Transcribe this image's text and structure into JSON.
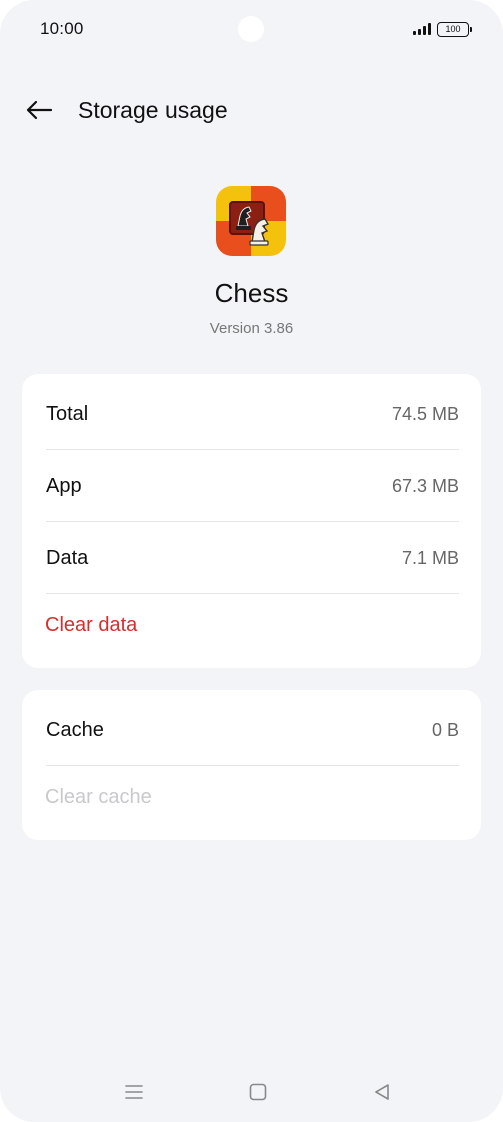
{
  "status_bar": {
    "time": "10:00",
    "battery_level": "100",
    "signal_icon": "signal-bars-icon"
  },
  "header": {
    "title": "Storage usage",
    "back_icon": "arrow-left-icon"
  },
  "app": {
    "name": "Chess",
    "version": "Version 3.86",
    "icon": "chess-app-icon",
    "icon_colors": [
      "#f4c20d",
      "#e84f1c",
      "#8a1f12"
    ]
  },
  "storage": {
    "rows": [
      {
        "label": "Total",
        "value": "74.5 MB"
      },
      {
        "label": "App",
        "value": "67.3 MB"
      },
      {
        "label": "Data",
        "value": "7.1 MB"
      }
    ],
    "clear_data_label": "Clear data"
  },
  "cache": {
    "label": "Cache",
    "value": "0 B",
    "clear_cache_label": "Clear cache"
  },
  "colors": {
    "background": "#f3f4f7",
    "card": "#ffffff",
    "danger": "#d32f2f",
    "disabled": "#c9c9cc"
  },
  "nav_bar": {
    "icons": [
      "menu-icon",
      "home-square-icon",
      "back-triangle-icon"
    ]
  }
}
